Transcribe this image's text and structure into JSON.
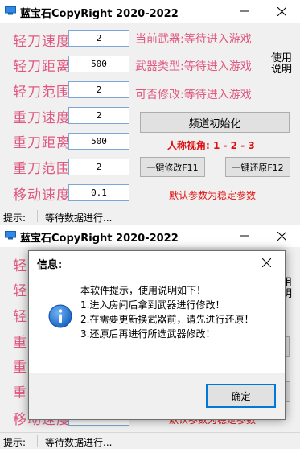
{
  "app": {
    "title": "蓝宝石CopyRight 2020-2022"
  },
  "form": {
    "rows": [
      {
        "label": "轻刀速度",
        "value": "2"
      },
      {
        "label": "轻刀距离",
        "value": "500"
      },
      {
        "label": "轻刀范围",
        "value": "2"
      },
      {
        "label": "重刀速度",
        "value": "2"
      },
      {
        "label": "重刀距离",
        "value": "500"
      },
      {
        "label": "重刀范围",
        "value": "2"
      },
      {
        "label": "移动速度",
        "value": "0.1"
      }
    ],
    "info": [
      "当前武器:等待进入游戏",
      "武器类型:等待进入游戏",
      "可否修改:等待进入游戏"
    ],
    "usage_line1": "使用",
    "usage_line2": "说明",
    "init_button": "频道初始化",
    "view_text": "人称视角: 1 - 2 - 3",
    "modify_button": "一键修改F11",
    "restore_button": "一键还原F12",
    "default_note": "默认参数为稳定参数"
  },
  "status": {
    "label": "提示:",
    "text": "等待数据进行..."
  },
  "dialog": {
    "title": "信息:",
    "lines": [
      "本软件提示，使用说明如下！",
      "1.进入房间后拿到武器进行修改！",
      "2.在需要更新换武器前，请先进行还原！",
      "3.还原后再进行所选武器修改！"
    ],
    "ok": "确定",
    "icon": "info-icon"
  },
  "colors": {
    "label": "#e0577f",
    "note": "#e01010",
    "input_border": "#7aa7d6",
    "accent": "#0078d7"
  }
}
